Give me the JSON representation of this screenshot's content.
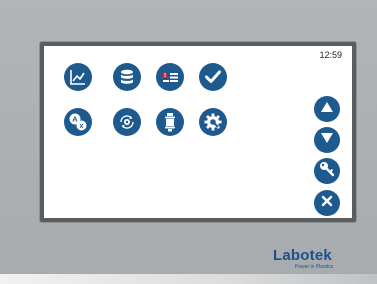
{
  "clock": {
    "time": "12:59"
  },
  "brand": {
    "name": "Labotek",
    "tagline": "Power in Plastics",
    "color": "#1f4f8a"
  },
  "colors": {
    "button": "#1f5a8f",
    "icon": "#ffffff",
    "alert": "#d7262b"
  },
  "main_buttons": [
    {
      "icon": "line-chart-icon"
    },
    {
      "icon": "database-icon"
    },
    {
      "icon": "alarm-list-icon"
    },
    {
      "icon": "checkmark-icon"
    },
    {
      "icon": "language-icon"
    },
    {
      "icon": "cycle-gear-icon"
    },
    {
      "icon": "device-icon"
    },
    {
      "icon": "settings-icon"
    }
  ],
  "side_buttons": [
    {
      "icon": "arrow-up-icon"
    },
    {
      "icon": "arrow-down-icon"
    },
    {
      "icon": "key-icon"
    },
    {
      "icon": "close-icon"
    }
  ]
}
